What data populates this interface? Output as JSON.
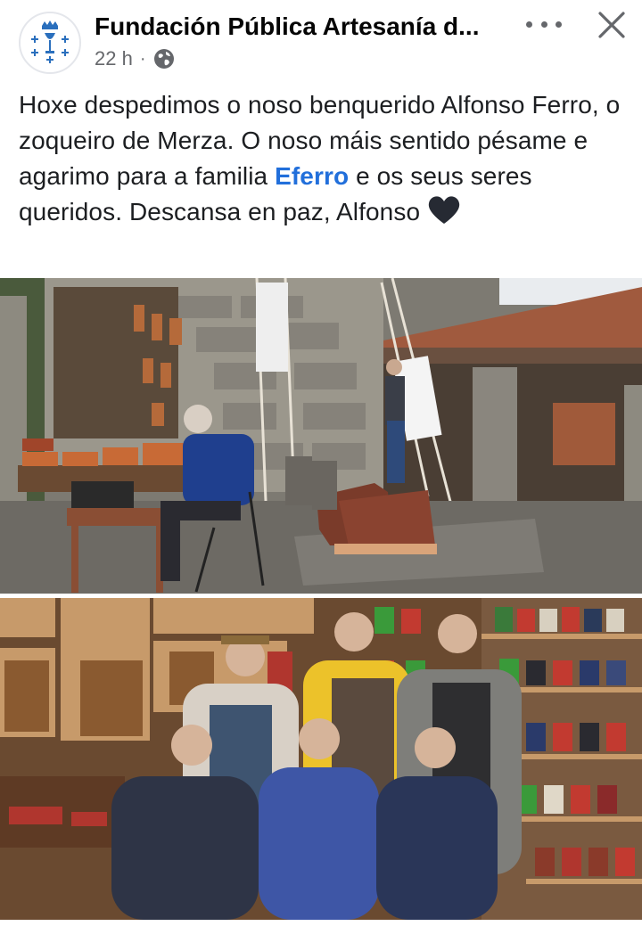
{
  "post": {
    "page_name": "Fundación Pública Artesanía d...",
    "timestamp": "22 h",
    "separator": "·",
    "text_before_mention": "Hoxe despedimos o noso benquerido Alfonso Ferro, o zoqueiro de Merza. O noso máis sentido pésame e agarimo para a familia ",
    "mention": "Eferro",
    "text_after_mention": " e os seus seres queridos. Descansa en paz, Alfonso ",
    "emoji": "black-heart"
  },
  "icons": {
    "avatar": "galicia-coat-of-arms-icon",
    "privacy": "globe-icon",
    "more": "more-options-icon",
    "close": "close-icon"
  },
  "colors": {
    "text": "#050505",
    "secondary_text": "#65676b",
    "mention": "#216fdb",
    "avatar_emblem": "#2a6fbd"
  },
  "photos": [
    {
      "description_tag": "outdoor-craft-fair-photo"
    },
    {
      "description_tag": "shoe-shop-family-photo"
    }
  ]
}
